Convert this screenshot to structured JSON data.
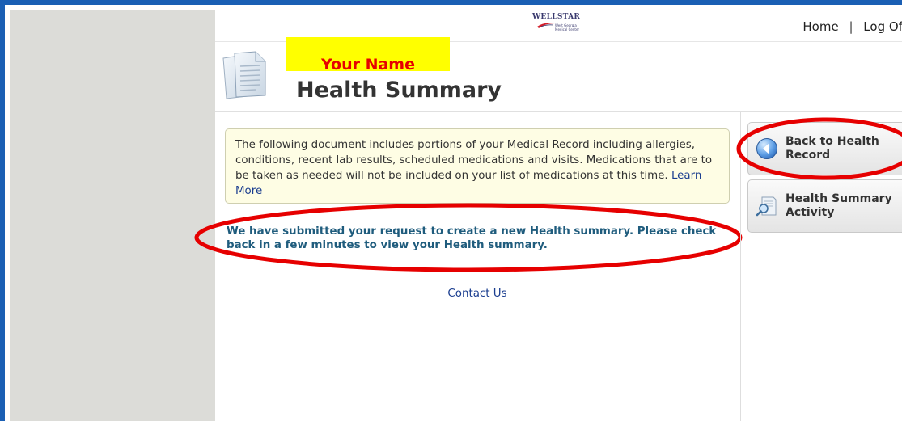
{
  "header": {
    "logo_text": "WELLSTAR",
    "logo_subtext": "West Georgia Medical Center",
    "nav": [
      {
        "label": "Home"
      },
      {
        "label": "Log Off"
      }
    ],
    "nav_separator": "|",
    "name_placeholder": "Your Name",
    "page_title": "Health Summary"
  },
  "main": {
    "info_text": "The following document includes portions of your Medical Record including allergies, conditions, recent lab results, scheduled medications and visits. Medications that are to be taken as needed will not be included on your list of medications at this time.",
    "learn_more": "Learn More",
    "submitted_message": "We have submitted your request to create a new Health summary. Please check back in a few minutes to view your Health summary.",
    "contact_link": "Contact Us"
  },
  "sidebar": {
    "buttons": [
      {
        "label": "Back to Health Record",
        "icon": "back-arrow-icon"
      },
      {
        "label": "Health Summary Activity",
        "icon": "document-magnifier-icon"
      }
    ]
  },
  "colors": {
    "frame_border": "#1a5fb4",
    "highlight_ring": "#e60000",
    "name_box_bg": "#ffff00",
    "message_text": "#1f5c7d",
    "link": "#1a3d8f"
  }
}
